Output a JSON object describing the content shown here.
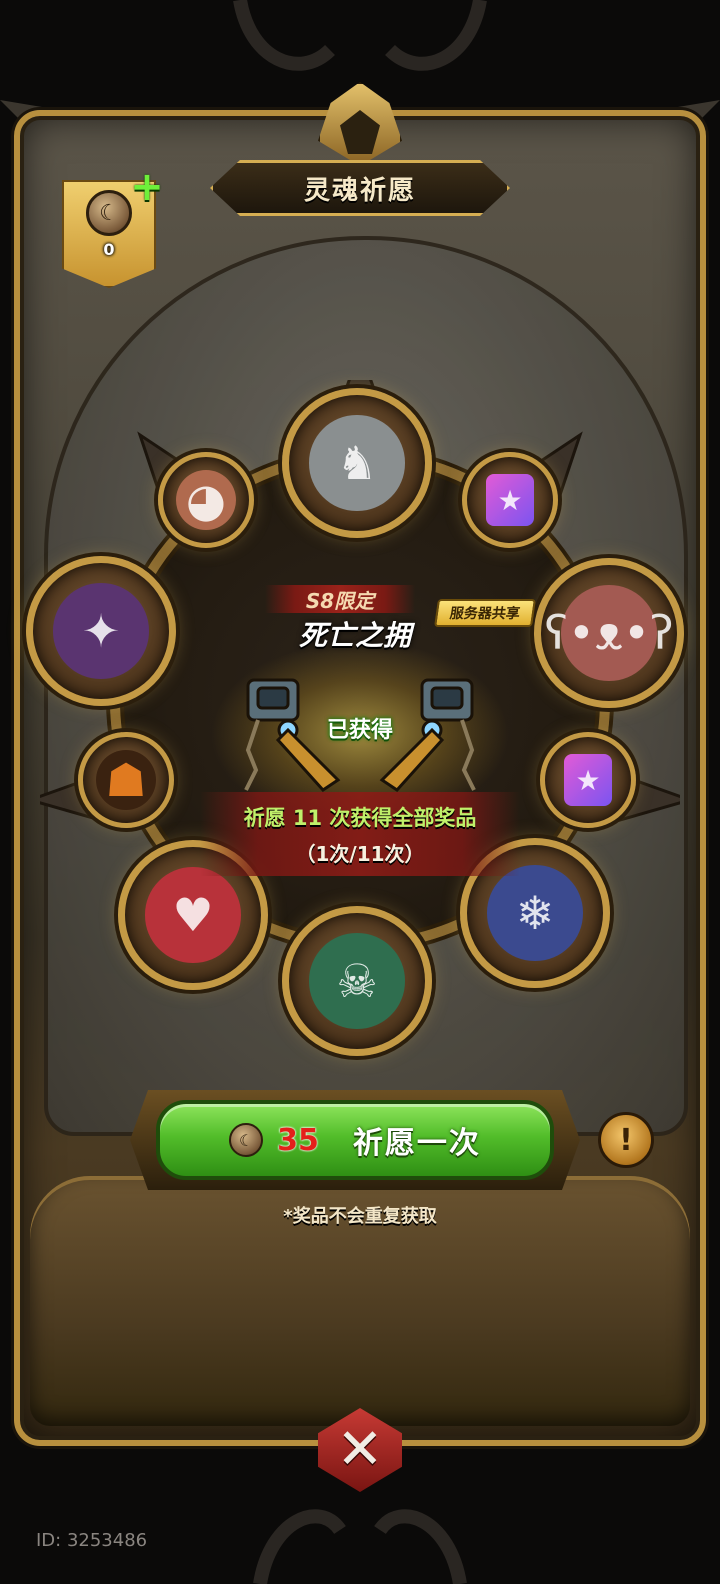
{
  "header": {
    "title": "灵魂祈愿"
  },
  "currency": {
    "count": "0",
    "add_icon": "plus-icon",
    "icon": "soul-coin-icon"
  },
  "wheel": {
    "featured_limited": "S8限定",
    "featured_name": "死亡之拥",
    "shared_tag": "服务器共享",
    "obtained_label": "已获得",
    "pray_info": "祈愿 11 次获得全部奖品",
    "pray_progress": "（1次/11次）",
    "rewards": [
      {
        "name": "horned-knight-avatar",
        "kind": "avatar"
      },
      {
        "name": "card-pack",
        "kind": "item"
      },
      {
        "name": "bear-avatar",
        "kind": "avatar"
      },
      {
        "name": "card-pack",
        "kind": "item"
      },
      {
        "name": "ice-witch-avatar",
        "kind": "avatar"
      },
      {
        "name": "green-pirate-avatar",
        "kind": "avatar"
      },
      {
        "name": "red-hair-girl-avatar",
        "kind": "avatar"
      },
      {
        "name": "pumpkin-frame",
        "kind": "item"
      },
      {
        "name": "purple-witch-avatar",
        "kind": "avatar"
      },
      {
        "name": "mushroom-monster",
        "kind": "item"
      }
    ]
  },
  "pray_button": {
    "cost": "35",
    "label": "祈愿一次"
  },
  "note": "*奖品不会重复获取",
  "footer": {
    "id_text": "ID: 3253486"
  },
  "colors": {
    "accent_gold": "#c49a45",
    "button_green": "#52bd2a",
    "cost_red": "#e4201a",
    "close_red": "#c63a34"
  }
}
